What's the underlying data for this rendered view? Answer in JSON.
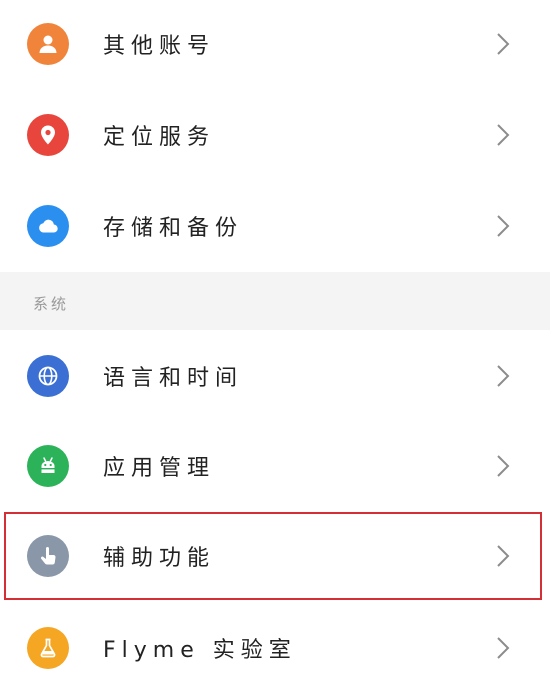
{
  "colors": {
    "accounts_icon": "#f0843a",
    "location_icon": "#e8453c",
    "storage_icon": "#2b8ff0",
    "language_icon": "#3b6fd4",
    "apps_icon": "#2cb35a",
    "accessibility_icon": "#8a97a8",
    "lab_icon": "#f5a623",
    "highlight_border": "#d32f36",
    "section_bg": "#f4f4f4"
  },
  "rows_top": [
    {
      "label": "其他账号",
      "icon": "person-icon"
    },
    {
      "label": "定位服务",
      "icon": "location-pin-icon"
    },
    {
      "label": "存储和备份",
      "icon": "cloud-icon"
    }
  ],
  "section": {
    "title": "系统"
  },
  "rows_system": [
    {
      "label": "语言和时间",
      "icon": "globe-icon"
    },
    {
      "label": "应用管理",
      "icon": "android-icon"
    },
    {
      "label": "辅助功能",
      "icon": "hand-pointer-icon",
      "highlighted": true
    },
    {
      "label": "Flyme 实验室",
      "icon": "flask-icon"
    }
  ]
}
